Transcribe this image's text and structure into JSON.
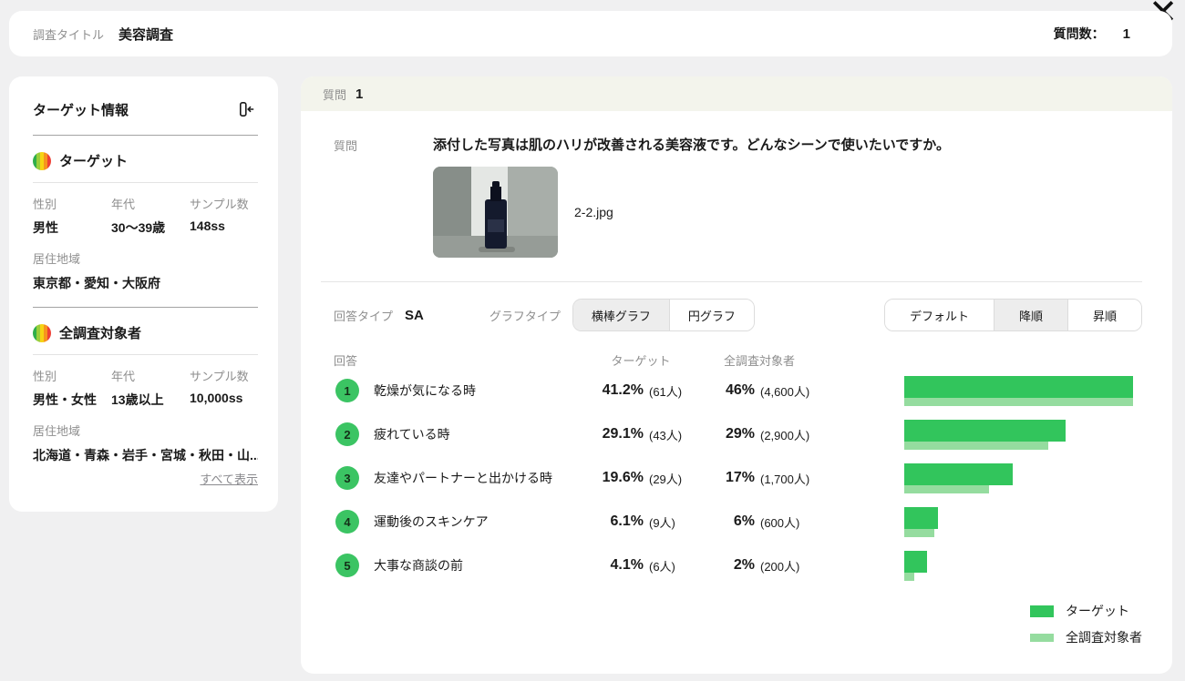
{
  "icons": {
    "close": "✕",
    "collapse": "collapse-panel-left",
    "rainbow": "target-color-scale"
  },
  "colors": {
    "target_green": "#32c55c",
    "all_green": "#95dc9f",
    "number_circle_green": "#3bc463",
    "band_bg": "#f3f4ec",
    "selected_segment_bg": "#ededed",
    "page_bg": "#f0f0f1"
  },
  "header": {
    "survey_title_label": "調査タイトル",
    "survey_title": "美容調査",
    "question_count_label": "質問数：",
    "question_count": "1"
  },
  "sidebar": {
    "title": "ターゲット情報",
    "sections": [
      {
        "name": "ターゲット",
        "fields": [
          {
            "label": "性別",
            "value": "男性"
          },
          {
            "label": "年代",
            "value": "30〜39歳"
          },
          {
            "label": "サンプル数",
            "value": "148ss"
          }
        ],
        "region_label": "居住地域",
        "region_value": "東京都・愛知・大阪府"
      },
      {
        "name": "全調査対象者",
        "fields": [
          {
            "label": "性別",
            "value": "男性・女性"
          },
          {
            "label": "年代",
            "value": "13歳以上"
          },
          {
            "label": "サンプル数",
            "value": "10,000ss"
          }
        ],
        "region_label": "居住地域",
        "region_value": "北海道・青森・岩手・宮城・秋田・山...",
        "show_all_label": "すべて表示"
      }
    ]
  },
  "main": {
    "question_band_label": "質問",
    "question_band_no": "1",
    "question_label": "質問",
    "question_text": "添付した写真は肌のハリが改善される美容液です。どんなシーンで使いたいですか。",
    "attachment_filename": "2-2.jpg",
    "answer_type_label": "回答タイプ",
    "answer_type": "SA",
    "graph_type_label": "グラフタイプ",
    "graph_tabs": [
      {
        "label": "横棒グラフ",
        "selected": true
      },
      {
        "label": "円グラフ",
        "selected": false
      }
    ],
    "sort_tabs": [
      {
        "label": "デフォルト",
        "selected": false
      },
      {
        "label": "降順",
        "selected": true
      },
      {
        "label": "昇順",
        "selected": false
      }
    ],
    "table_headers": {
      "answer": "回答",
      "target": "ターゲット",
      "all": "全調査対象者"
    }
  },
  "answers": [
    {
      "no": "1",
      "label": "乾燥が気になる時",
      "target_pct": "41.2%",
      "target_count": "(61人)",
      "all_pct": "46%",
      "all_count": "(4,600人)",
      "target_val": 41.2,
      "all_val": 46
    },
    {
      "no": "2",
      "label": "疲れている時",
      "target_pct": "29.1%",
      "target_count": "(43人)",
      "all_pct": "29%",
      "all_count": "(2,900人)",
      "target_val": 29.1,
      "all_val": 29
    },
    {
      "no": "3",
      "label": "友達やパートナーと出かける時",
      "target_pct": "19.6%",
      "target_count": "(29人)",
      "all_pct": "17%",
      "all_count": "(1,700人)",
      "target_val": 19.6,
      "all_val": 17
    },
    {
      "no": "4",
      "label": "運動後のスキンケア",
      "target_pct": "6.1%",
      "target_count": "(9人)",
      "all_pct": "6%",
      "all_count": "(600人)",
      "target_val": 6.1,
      "all_val": 6
    },
    {
      "no": "5",
      "label": "大事な商談の前",
      "target_pct": "4.1%",
      "target_count": "(6人)",
      "all_pct": "2%",
      "all_count": "(200人)",
      "target_val": 4.1,
      "all_val": 2
    }
  ],
  "legend": [
    {
      "label": "ターゲット",
      "color": "#32c55c"
    },
    {
      "label": "全調査対象者",
      "color": "#95dc9f"
    }
  ],
  "chart_data": {
    "type": "bar",
    "orientation": "horizontal",
    "title": "",
    "categories": [
      "乾燥が気になる時",
      "疲れている時",
      "友達やパートナーと出かける時",
      "運動後のスキンケア",
      "大事な商談の前"
    ],
    "series": [
      {
        "name": "ターゲット",
        "values_pct": [
          41.2,
          29.1,
          19.6,
          6.1,
          4.1
        ],
        "counts": [
          61,
          43,
          29,
          9,
          6
        ],
        "color": "#32c55c"
      },
      {
        "name": "全調査対象者",
        "values_pct": [
          46,
          29,
          17,
          6,
          2
        ],
        "counts": [
          4600,
          2900,
          1700,
          600,
          200
        ],
        "color": "#95dc9f"
      }
    ],
    "scaling": "each series drawn relative to its own maximum value",
    "grid": false,
    "legend_position": "bottom-right",
    "sort": "descending"
  }
}
